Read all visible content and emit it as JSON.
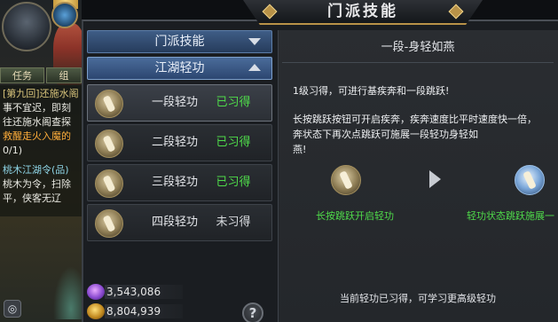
{
  "window": {
    "title": "门派技能"
  },
  "game_hud": {
    "tabs": [
      "任务",
      "组"
    ],
    "quest_lines": [
      {
        "text": "[第九回]还施水阁",
        "tone": "head"
      },
      {
        "text": "事不宜迟，即刻",
        "tone": "white"
      },
      {
        "text": "往还施水阁查探",
        "tone": "white"
      },
      {
        "text": "救醒走火入魔的",
        "tone": "orange"
      },
      {
        "text": "0/1)",
        "tone": "white"
      },
      {
        "text": "桃木江湖令(品)",
        "tone": "cyan"
      },
      {
        "text": "桃木为令，扫除",
        "tone": "white"
      },
      {
        "text": "平，侠客无辽",
        "tone": "white"
      }
    ],
    "camera_label": "◎"
  },
  "skill_list": {
    "categories": [
      {
        "label": "门派技能",
        "expanded": false
      },
      {
        "label": "江湖轻功",
        "expanded": true
      }
    ],
    "skills": [
      {
        "name": "一段轻功",
        "status": "已习得",
        "learned": true,
        "selected": true
      },
      {
        "name": "二段轻功",
        "status": "已习得",
        "learned": true,
        "selected": false
      },
      {
        "name": "三段轻功",
        "status": "已习得",
        "learned": true,
        "selected": false
      },
      {
        "name": "四段轻功",
        "status": "未习得",
        "learned": false,
        "selected": false
      }
    ]
  },
  "currencies": [
    {
      "icon": "gem-icon",
      "value": "3,543,086"
    },
    {
      "icon": "gold-coin-icon",
      "value": "8,804,939"
    }
  ],
  "help_label": "?",
  "detail": {
    "title": "一段-身轻如燕",
    "requirement": "1级习得，可进行基疾奔和一段跳跃!",
    "description_lines": [
      "长按跳跃按钮可开启疾奔，疾奔速度比平时速度快一倍，",
      "奔状态下再次点跳跃可施展一段轻功身轻如",
      "燕!"
    ],
    "steps": [
      {
        "caption": "长按跳跃开启轻功"
      },
      {
        "caption": "轻功状态跳跃施展一"
      }
    ],
    "footer": "当前轻功已习得，可学习更高级轻功"
  },
  "colors": {
    "learned": "#4fdc4a",
    "not_learned": "#d9dce0",
    "header_blue": "#3f5d86",
    "gold_trim": "#b89248"
  }
}
